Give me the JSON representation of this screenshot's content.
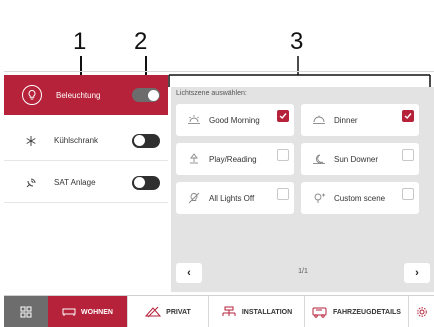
{
  "callouts": {
    "one": "1",
    "two": "2",
    "three": "3"
  },
  "devices": [
    {
      "label": "Beleuchtung",
      "icon": "lightbulb-icon",
      "active": true,
      "toggle": "on"
    },
    {
      "label": "Kühlschrank",
      "icon": "snowflake-icon",
      "active": false,
      "toggle": "off"
    },
    {
      "label": "SAT Anlage",
      "icon": "satellite-icon",
      "active": false,
      "toggle": "off"
    }
  ],
  "scene_panel": {
    "title": "Lichtszene auswählen:",
    "scenes": [
      {
        "label": "Good Morning",
        "icon": "sunrise-icon",
        "checked": true
      },
      {
        "label": "Dinner",
        "icon": "dinner-icon",
        "checked": true
      },
      {
        "label": "Play/Reading",
        "icon": "reading-lamp-icon",
        "checked": false
      },
      {
        "label": "Sun Downer",
        "icon": "sunset-icon",
        "checked": false
      },
      {
        "label": "All Lights Off",
        "icon": "lights-off-icon",
        "checked": false
      },
      {
        "label": "Custom scene",
        "icon": "custom-scene-icon",
        "checked": false
      }
    ],
    "pager": {
      "prev": "‹",
      "next": "›",
      "page": "1/1"
    }
  },
  "bottom_nav": {
    "items": [
      {
        "label": "WOHNEN",
        "icon": "sofa-icon",
        "active": true
      },
      {
        "label": "PRIVAT",
        "icon": "privat-icon",
        "active": false
      },
      {
        "label": "INSTALLATION",
        "icon": "installation-icon",
        "active": false
      },
      {
        "label": "FAHRZEUGDETAILS",
        "icon": "vehicle-icon",
        "active": false
      }
    ]
  },
  "colors": {
    "accent": "#b5223a",
    "panel": "#e3e3e3",
    "toggle_dark": "#2f2f2f"
  }
}
